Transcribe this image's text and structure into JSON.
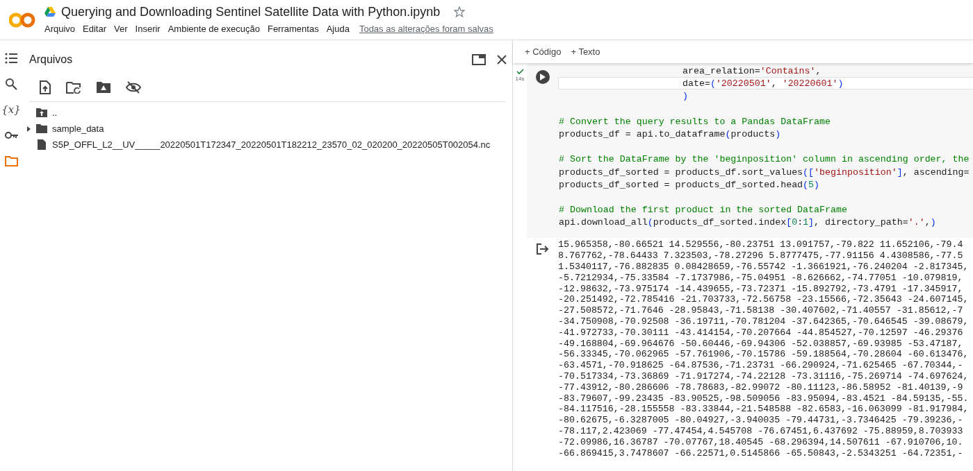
{
  "header": {
    "title": "Querying and Downloading Sentinel Satellite Data with Python.ipynb",
    "menu": [
      "Arquivo",
      "Editar",
      "Ver",
      "Inserir",
      "Ambiente de execução",
      "Ferramentas",
      "Ajuda"
    ],
    "save_status": "Todas as alterações foram salvas"
  },
  "sidebar": {
    "icons": [
      {
        "kind": "toc",
        "selected": false
      },
      {
        "kind": "search",
        "selected": false
      },
      {
        "kind": "variables",
        "glyph": "{x}",
        "selected": false
      },
      {
        "kind": "secrets",
        "selected": false
      },
      {
        "kind": "files",
        "selected": true
      }
    ]
  },
  "files_panel": {
    "title": "Arquivos",
    "entries": [
      {
        "kind": "parent",
        "name": "..",
        "expandable": false
      },
      {
        "kind": "folder",
        "name": "sample_data",
        "expandable": true
      },
      {
        "kind": "file",
        "name": "S5P_OFFL_L2__UV_____20220501T172347_20220501T182212_23570_02_020200_20220505T002054.nc",
        "expandable": false
      }
    ]
  },
  "toolbar": {
    "buttons": [
      "+ Código",
      "+ Texto"
    ]
  },
  "cell": {
    "duration": "14s",
    "lines": [
      {
        "active": false,
        "indent": true,
        "space_before": false,
        "tokens": [
          {
            "kind": "plain",
            "text": "area_relation="
          },
          {
            "kind": "string",
            "text": "'Contains'"
          },
          {
            "kind": "plain",
            "text": ","
          }
        ]
      },
      {
        "active": true,
        "indent": true,
        "space_before": false,
        "tokens": [
          {
            "kind": "plain",
            "text": "date="
          },
          {
            "kind": "bracket",
            "text": "("
          },
          {
            "kind": "string",
            "text": "'20220501'"
          },
          {
            "kind": "plain",
            "text": ", "
          },
          {
            "kind": "string",
            "text": "'20220601'"
          },
          {
            "kind": "bracket",
            "text": ")"
          }
        ]
      },
      {
        "active": false,
        "indent": true,
        "space_before": false,
        "tokens": [
          {
            "kind": "bracket",
            "text": ")"
          }
        ]
      },
      {
        "active": false,
        "indent": false,
        "space_before": true,
        "tokens": [
          {
            "kind": "comment",
            "text": "# Convert the query results to a Pandas DataFrame"
          }
        ]
      },
      {
        "active": false,
        "indent": false,
        "space_before": false,
        "tokens": [
          {
            "kind": "plain",
            "text": "products_df = api.to_dataframe"
          },
          {
            "kind": "bracket",
            "text": "("
          },
          {
            "kind": "plain",
            "text": "products"
          },
          {
            "kind": "bracket",
            "text": ")"
          }
        ]
      },
      {
        "active": false,
        "indent": false,
        "space_before": true,
        "tokens": [
          {
            "kind": "comment",
            "text": "# Sort the DataFrame by the 'beginposition' column in ascending order, the"
          }
        ]
      },
      {
        "active": false,
        "indent": false,
        "space_before": false,
        "tokens": [
          {
            "kind": "plain",
            "text": "products_df_sorted = products_df.sort_values"
          },
          {
            "kind": "bracket",
            "text": "(["
          },
          {
            "kind": "string",
            "text": "'beginposition'"
          },
          {
            "kind": "bracket",
            "text": "]"
          },
          {
            "kind": "plain",
            "text": ", ascending="
          }
        ]
      },
      {
        "active": false,
        "indent": false,
        "space_before": false,
        "tokens": [
          {
            "kind": "plain",
            "text": "products_df_sorted = products_df_sorted.head"
          },
          {
            "kind": "bracket",
            "text": "("
          },
          {
            "kind": "number",
            "text": "5"
          },
          {
            "kind": "bracket",
            "text": ")"
          }
        ]
      },
      {
        "active": false,
        "indent": false,
        "space_before": true,
        "tokens": [
          {
            "kind": "comment",
            "text": "# Download the first product in the sorted DataFrame"
          }
        ]
      },
      {
        "active": false,
        "indent": false,
        "space_before": false,
        "tokens": [
          {
            "kind": "plain",
            "text": "api.download_all"
          },
          {
            "kind": "bracket",
            "text": "("
          },
          {
            "kind": "plain",
            "text": "products_df_sorted.index"
          },
          {
            "kind": "bracket",
            "text": "["
          },
          {
            "kind": "number",
            "text": "0"
          },
          {
            "kind": "plain",
            "text": ":"
          },
          {
            "kind": "number",
            "text": "1"
          },
          {
            "kind": "bracket",
            "text": "]"
          },
          {
            "kind": "plain",
            "text": ", directory_path="
          },
          {
            "kind": "string",
            "text": "'.'"
          },
          {
            "kind": "plain",
            "text": ","
          },
          {
            "kind": "bracket",
            "text": ")"
          }
        ]
      }
    ],
    "output": [
      "15.965358,-80.66521 14.529556,-80.23751 13.091757,-79.822 11.652106,-79.4",
      "8.767762,-78.64433 7.323503,-78.27296 5.8777475,-77.91156 4.4308586,-77.5",
      "1.5340117,-76.882835 0.08428659,-76.55742 -1.3661921,-76.240204 -2.817345,",
      "-5.7212934,-75.33584 -7.1737986,-75.04951 -8.626662,-74.77051 -10.079819,",
      "-12.98632,-73.975174 -14.439655,-73.72371 -15.892792,-73.4791 -17.345917,",
      "-20.251492,-72.785416 -21.703733,-72.56758 -23.15566,-72.35643 -24.607145,",
      "-27.508572,-71.7646 -28.95843,-71.58138 -30.407602,-71.40557 -31.85612,-7",
      "-34.750908,-70.92508 -36.19711,-70.781204 -37.642365,-70.646545 -39.08679,",
      "-41.972733,-70.30111 -43.414154,-70.207664 -44.854527,-70.12597 -46.29376",
      "-49.168804,-69.964676 -50.60446,-69.94306 -52.038857,-69.93985 -53.47187,",
      "-56.33345,-70.062965 -57.761906,-70.15786 -59.188564,-70.28604 -60.613476,",
      "-63.4571,-70.918625 -64.87536,-71.23731 -66.290924,-71.625465 -67.70344,-",
      "-70.517334,-73.36869 -71.917274,-74.22128 -73.31116,-75.269714 -74.697624,",
      "-77.43912,-80.286606 -78.78683,-82.99072 -80.11123,-86.58952 -81.40139,-9",
      "-83.79607,-99.23435 -83.90525,-98.509056 -83.95094,-83.4521 -84.59135,-55.",
      "-84.117516,-28.155558 -83.33844,-21.548588 -82.6583,-16.063099 -81.917984,",
      "-80.62675,-6.3287005 -80.04927,-3.940035 -79.44731,-3.7346425 -79.39236,-",
      "-78.117,2.423069 -77.47454,4.545708 -76.67451,6.437692 -75.88959,8.703933",
      "-72.09986,16.36787 -70.07767,18.40545 -68.296394,14.507611 -67.910706,10.",
      "-66.869415,3.7478607 -66.22571,0.5145866 -65.50843,-2.5343251 -64.72351,-"
    ]
  }
}
